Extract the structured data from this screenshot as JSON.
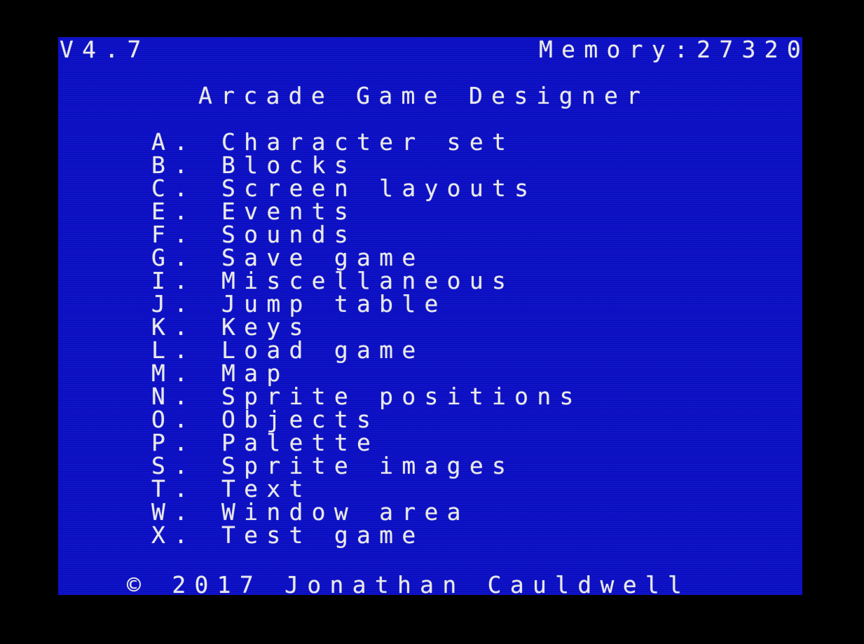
{
  "header": {
    "version": "V4.7",
    "memory": "Memory:27320"
  },
  "title": "Arcade Game Designer",
  "menu": [
    {
      "key": "A.",
      "label": "Character set"
    },
    {
      "key": "B.",
      "label": "Blocks"
    },
    {
      "key": "C.",
      "label": "Screen layouts"
    },
    {
      "key": "E.",
      "label": "Events"
    },
    {
      "key": "F.",
      "label": "Sounds"
    },
    {
      "key": "G.",
      "label": "Save game"
    },
    {
      "key": "I.",
      "label": "Miscellaneous"
    },
    {
      "key": "J.",
      "label": "Jump table"
    },
    {
      "key": "K.",
      "label": "Keys"
    },
    {
      "key": "L.",
      "label": "Load game"
    },
    {
      "key": "M.",
      "label": "Map"
    },
    {
      "key": "N.",
      "label": "Sprite positions"
    },
    {
      "key": "O.",
      "label": "Objects"
    },
    {
      "key": "P.",
      "label": "Palette"
    },
    {
      "key": "S.",
      "label": "Sprite images"
    },
    {
      "key": "T.",
      "label": "Text"
    },
    {
      "key": "W.",
      "label": "Window area"
    },
    {
      "key": "X.",
      "label": "Test game"
    }
  ],
  "footer": {
    "copyright": "© 2017 Jonathan Cauldwell"
  },
  "colors": {
    "border": "#000000",
    "paper": "#0a0ec8",
    "ink": "#f0f0f0"
  }
}
